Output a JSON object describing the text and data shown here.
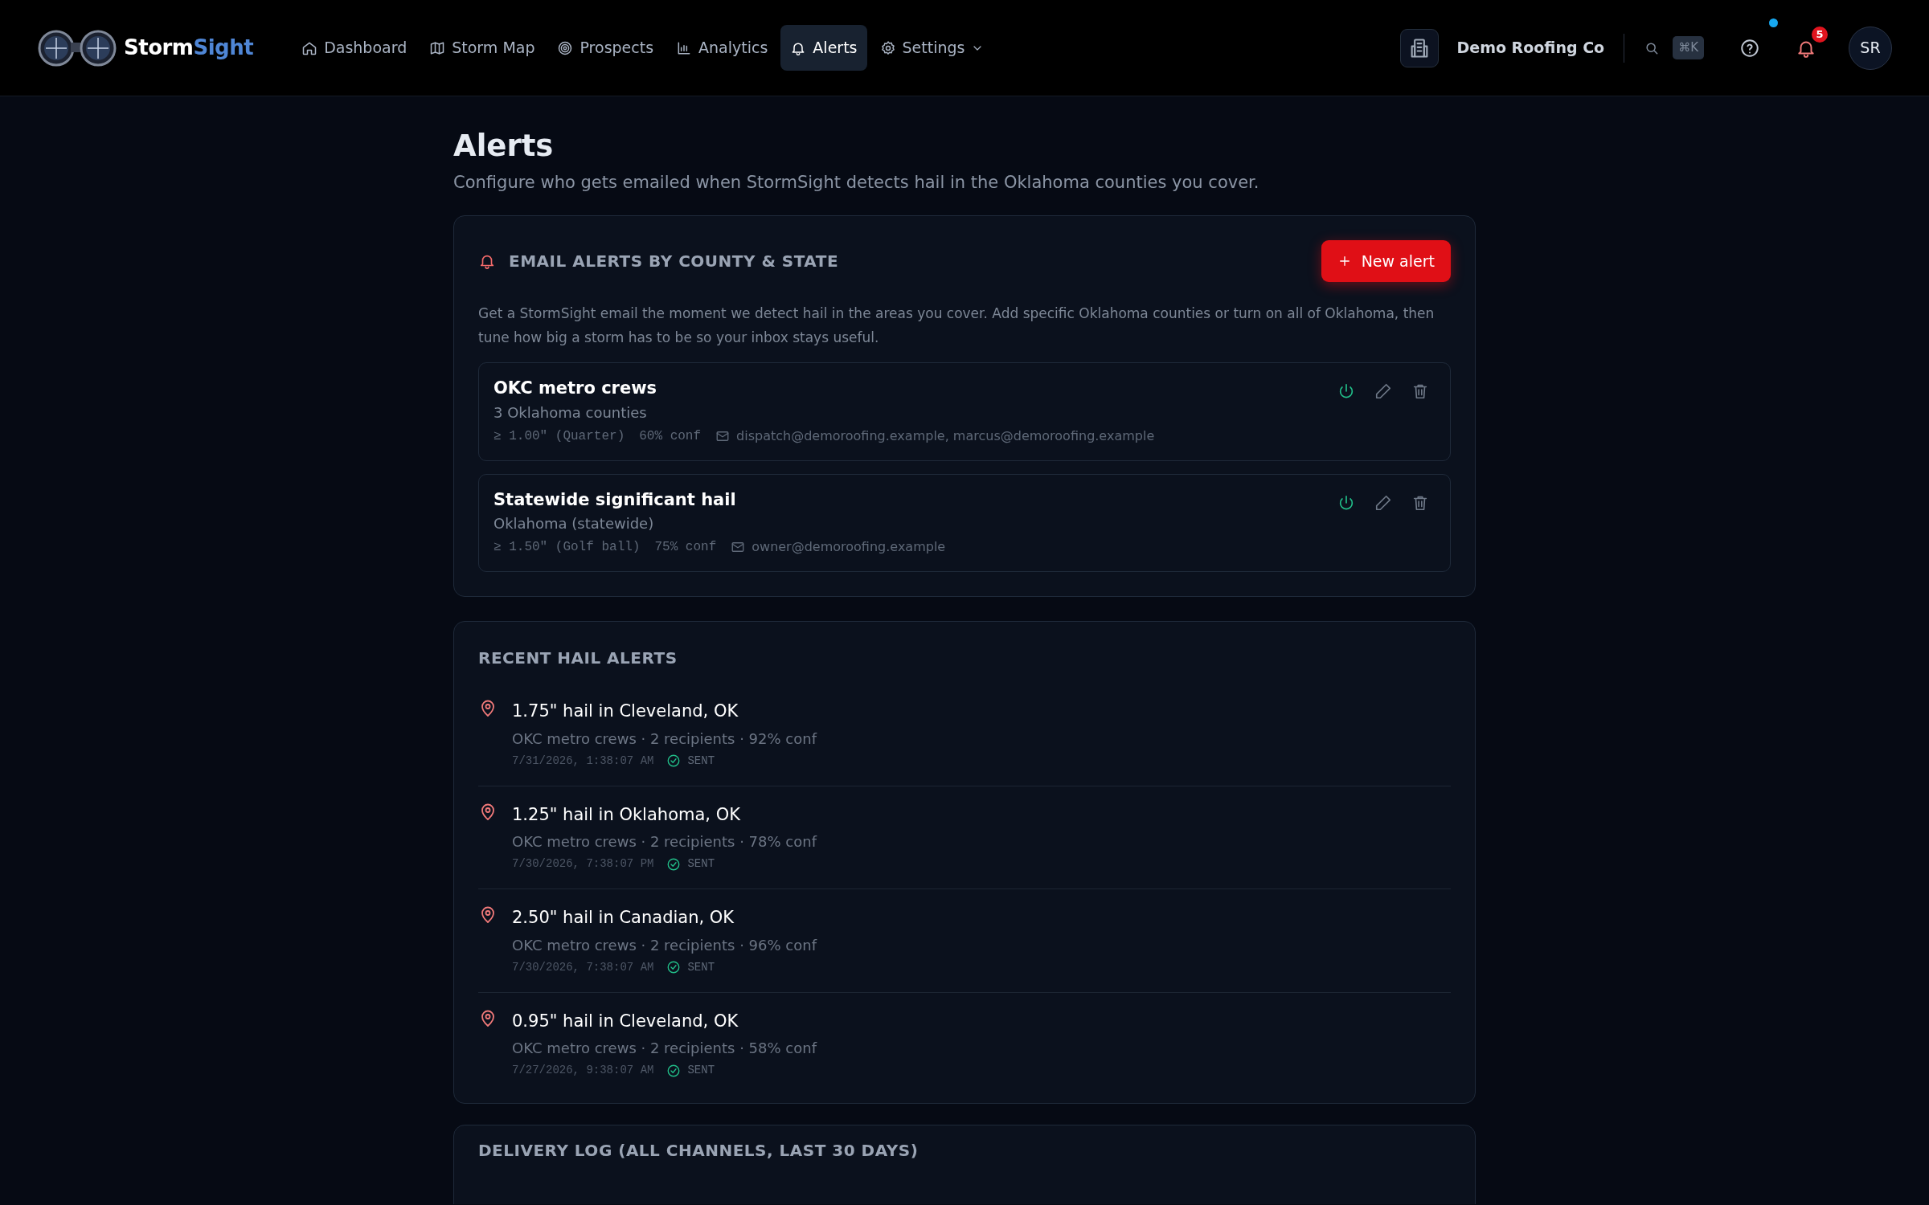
{
  "brand": {
    "first": "Storm",
    "second": "Sight"
  },
  "nav": [
    {
      "label": "Dashboard",
      "selected": false,
      "dropdown": false
    },
    {
      "label": "Storm Map",
      "selected": false,
      "dropdown": false
    },
    {
      "label": "Prospects",
      "selected": false,
      "dropdown": false
    },
    {
      "label": "Analytics",
      "selected": false,
      "dropdown": false
    },
    {
      "label": "Alerts",
      "selected": true,
      "dropdown": false
    },
    {
      "label": "Settings",
      "selected": false,
      "dropdown": true
    }
  ],
  "org": {
    "name": "Demo Roofing Co"
  },
  "search": {
    "shortcut": "⌘K"
  },
  "help": {
    "dot": true
  },
  "notifications": {
    "count": "5"
  },
  "avatar": {
    "initials": "SR"
  },
  "page": {
    "title": "Alerts",
    "subtitle": "Configure who gets emailed when StormSight detects hail in the Oklahoma counties you cover."
  },
  "email_alerts": {
    "heading": "EMAIL ALERTS BY COUNTY & STATE",
    "button": "New alert",
    "description": "Get a StormSight email the moment we detect hail in the areas you cover. Add specific Oklahoma counties or turn on all of Oklahoma, then tune how big a storm has to be so your inbox stays useful.",
    "rules": [
      {
        "name": "OKC metro crews",
        "area": "3 Oklahoma counties",
        "size": "≥ 1.00\" (Quarter)",
        "conf": "60% conf",
        "recipients": "dispatch@demoroofing.example, marcus@demoroofing.example",
        "on": true
      },
      {
        "name": "Statewide significant hail",
        "area": "Oklahoma (statewide)",
        "size": "≥ 1.50\" (Golf ball)",
        "conf": "75% conf",
        "recipients": "owner@demoroofing.example",
        "on": true
      }
    ]
  },
  "recent": {
    "heading": "RECENT HAIL ALERTS",
    "items": [
      {
        "title": "1.75\" hail in Cleveland, OK",
        "meta": "OKC metro crews · 2 recipients · 92% conf",
        "time": "7/31/2026, 1:38:07 AM",
        "status": "SENT"
      },
      {
        "title": "1.25\" hail in Oklahoma, OK",
        "meta": "OKC metro crews · 2 recipients · 78% conf",
        "time": "7/30/2026, 7:38:07 PM",
        "status": "SENT"
      },
      {
        "title": "2.50\" hail in Canadian, OK",
        "meta": "OKC metro crews · 2 recipients · 96% conf",
        "time": "7/30/2026, 7:38:07 AM",
        "status": "SENT"
      },
      {
        "title": "0.95\" hail in Cleveland, OK",
        "meta": "OKC metro crews · 2 recipients · 58% conf",
        "time": "7/27/2026, 9:38:07 AM",
        "status": "SENT"
      }
    ]
  },
  "delivery_log": {
    "heading": "DELIVERY LOG (ALL CHANNELS, LAST 30 DAYS)"
  }
}
